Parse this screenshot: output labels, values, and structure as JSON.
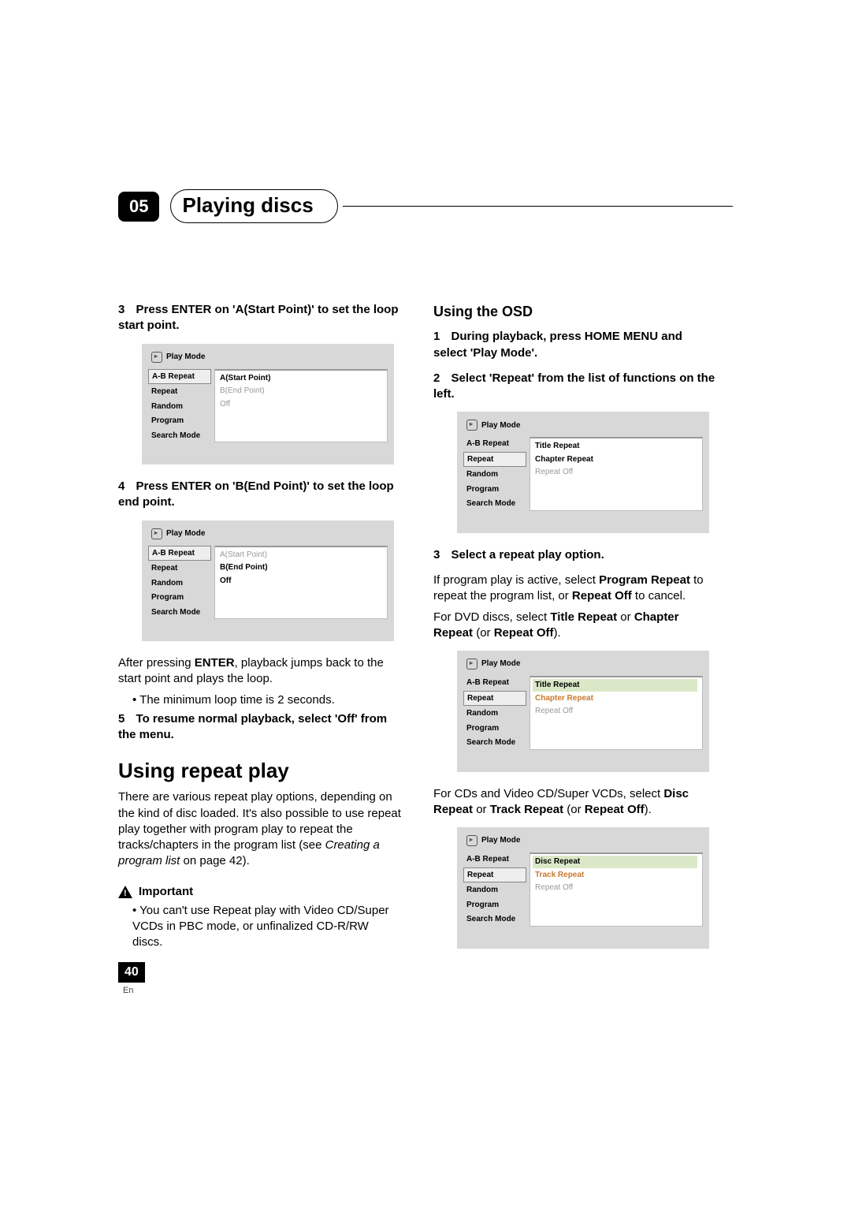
{
  "chapter": {
    "num": "05",
    "title": "Playing discs"
  },
  "page": {
    "num": "40",
    "lang": "En"
  },
  "osd_common": {
    "title": "Play Mode",
    "left_items": [
      "A-B Repeat",
      "Repeat",
      "Random",
      "Program",
      "Search Mode"
    ]
  },
  "left_col": {
    "step3": {
      "n": "3",
      "text": "Press ENTER on 'A(Start Point)' to set the loop start point."
    },
    "osd1": {
      "selected": 0,
      "vals": [
        {
          "text": "A(Start Point)",
          "cls": "bold"
        },
        {
          "text": "B(End Point)",
          "cls": "grey"
        },
        {
          "text": "Off",
          "cls": "grey"
        }
      ]
    },
    "step4": {
      "n": "4",
      "text": "Press ENTER on 'B(End Point)' to set the loop end point."
    },
    "osd2": {
      "selected": 0,
      "vals": [
        {
          "text": "A(Start Point)",
          "cls": "grey"
        },
        {
          "text": "B(End Point)",
          "cls": "bold"
        },
        {
          "text": "Off",
          "cls": "bold"
        }
      ]
    },
    "after1a": "After pressing ",
    "after1b": "ENTER",
    "after1c": ", playback jumps back to the start point and plays the loop.",
    "bullet1": "The minimum loop time is 2 seconds.",
    "step5": {
      "n": "5",
      "text": "To resume normal playback, select 'Off' from the menu."
    },
    "section": "Using repeat play",
    "para1a": "There are various repeat play options, depending on the kind of disc loaded. It's also possible to use repeat play together with program play to repeat the tracks/chapters in the program list (see ",
    "para1b": "Creating a program list",
    "para1c": " on page 42).",
    "important": "Important",
    "imp_bullet": "You can't use Repeat play with Video CD/Super VCDs in PBC mode, or unfinalized CD-R/RW discs."
  },
  "right_col": {
    "subsection": "Using the OSD",
    "step1": {
      "n": "1",
      "text": "During playback, press HOME MENU and select 'Play Mode'."
    },
    "step2": {
      "n": "2",
      "text": "Select 'Repeat' from the list of functions on the left."
    },
    "osd3": {
      "selected": 1,
      "vals": [
        {
          "text": "Title Repeat",
          "cls": "bold"
        },
        {
          "text": "Chapter Repeat",
          "cls": "bold"
        },
        {
          "text": "Repeat Off",
          "cls": "grey"
        }
      ]
    },
    "step3": {
      "n": "3",
      "text": "Select a repeat play option."
    },
    "p3a": "If program play is active, select ",
    "p3b": "Program Repeat",
    "p3c": " to repeat the program list, or ",
    "p3d": "Repeat Off",
    "p3e": " to cancel.",
    "p4a": "For DVD discs, select ",
    "p4b": "Title Repeat",
    "p4c": " or ",
    "p4d": "Chapter Repeat",
    "p4e": " (or ",
    "p4f": "Repeat Off",
    "p4g": ").",
    "osd4": {
      "selected": 1,
      "vals": [
        {
          "text": "Title Repeat",
          "cls": "hl"
        },
        {
          "text": "Chapter Repeat",
          "cls": "orange"
        },
        {
          "text": "Repeat Off",
          "cls": "grey"
        }
      ]
    },
    "p5a": "For CDs and Video CD/Super VCDs, select ",
    "p5b": "Disc Repeat",
    "p5c": " or ",
    "p5d": "Track Repeat",
    "p5e": " (or ",
    "p5f": "Repeat Off",
    "p5g": ").",
    "osd5": {
      "selected": 1,
      "vals": [
        {
          "text": "Disc Repeat",
          "cls": "hl"
        },
        {
          "text": "Track Repeat",
          "cls": "orange"
        },
        {
          "text": "Repeat Off",
          "cls": "grey"
        }
      ]
    }
  }
}
